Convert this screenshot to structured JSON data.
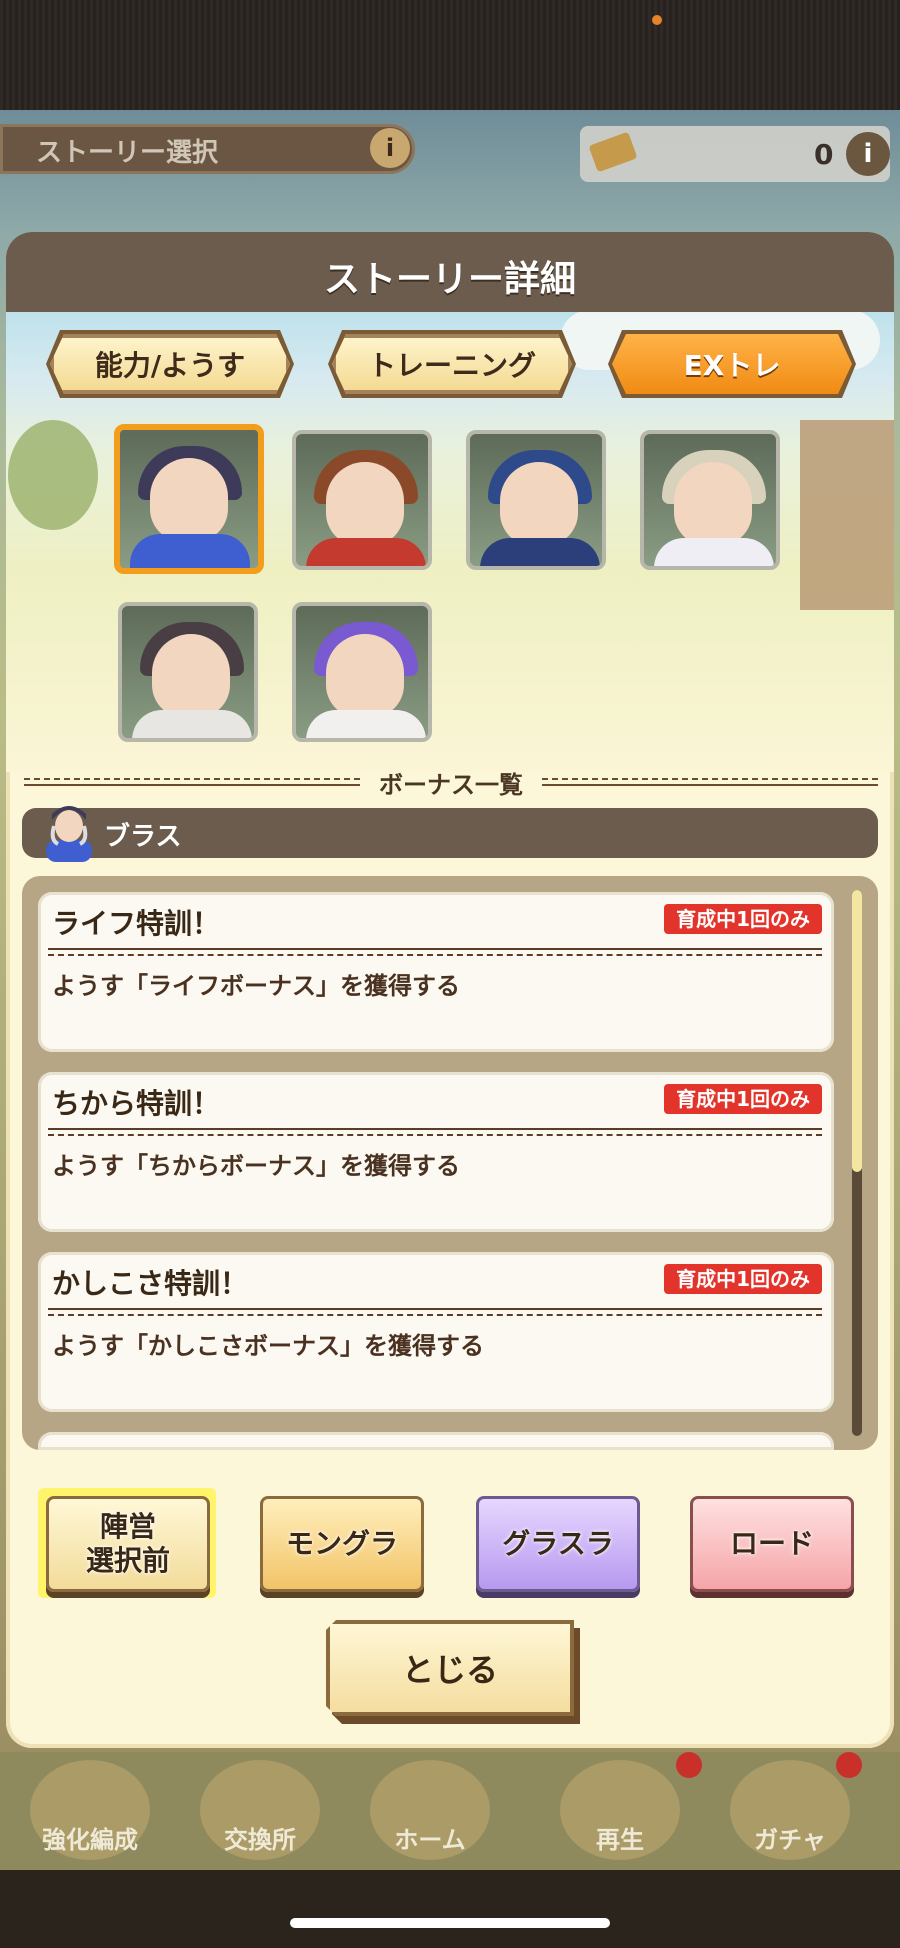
{
  "background": {
    "story_select_title": "ストーリー選択",
    "currency_count": "0",
    "info_icon": "i",
    "bottom_nav": [
      "強化編成",
      "交換所",
      "ホーム",
      "再生",
      "ガチャ"
    ]
  },
  "modal": {
    "title": "ストーリー詳細",
    "tabs": [
      {
        "label": "能力/ようす",
        "active": false
      },
      {
        "label": "トレーニング",
        "active": false
      },
      {
        "label": "EXトレ",
        "active": true
      }
    ],
    "bonus_section_title": "ボーナス一覧",
    "character_name": "ブラス",
    "bonus_cards": [
      {
        "title": "ライフ特訓！",
        "badge": "育成中1回のみ",
        "description": "ようす「ライフボーナス」を獲得する"
      },
      {
        "title": "ちから特訓！",
        "badge": "育成中1回のみ",
        "description": "ようす「ちからボーナス」を獲得する"
      },
      {
        "title": "かしこさ特訓！",
        "badge": "育成中1回のみ",
        "description": "ようす「かしこさボーナス」を獲得する"
      }
    ],
    "route_buttons": {
      "camp": "陣営\n選択前",
      "mongura": "モングラ",
      "gurasura": "グラスラ",
      "road": "ロード"
    },
    "close_label": "とじる"
  },
  "colors": {
    "accent_orange": "#f08b14",
    "badge_red": "#e3342b",
    "header_brown": "#6b5c4e"
  }
}
